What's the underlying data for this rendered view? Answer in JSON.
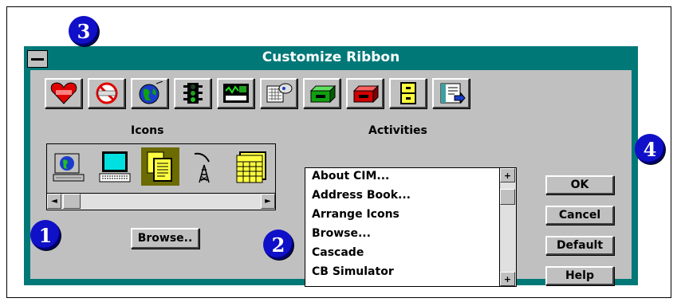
{
  "dialog": {
    "title": "Customize Ribbon"
  },
  "callouts": [
    "1",
    "2",
    "3",
    "4"
  ],
  "toolbar": {
    "buttons": [
      {
        "icon": "heart-icon"
      },
      {
        "icon": "no-entry-icon"
      },
      {
        "icon": "globe-icon"
      },
      {
        "icon": "traffic-light-icon"
      },
      {
        "icon": "monitor-chart-icon"
      },
      {
        "icon": "puzzle-icon"
      },
      {
        "icon": "green-box-icon"
      },
      {
        "icon": "red-box-icon"
      },
      {
        "icon": "file-cabinet-icon"
      },
      {
        "icon": "book-arrow-icon"
      }
    ]
  },
  "icons_panel": {
    "heading": "Icons",
    "items": [
      "computer-globe-icon",
      "terminal-icon",
      "documents-icon",
      "antenna-tower-icon",
      "calendar-icon"
    ],
    "selected_index": 2
  },
  "activities": {
    "heading": "Activities",
    "items": [
      "About CIM...",
      "Address Book...",
      "Arrange Icons",
      "Browse...",
      "Cascade",
      "CB Simulator"
    ]
  },
  "buttons": {
    "browse": "Browse..",
    "ok": "OK",
    "cancel": "Cancel",
    "default": "Default",
    "help": "Help"
  },
  "colors": {
    "title_bar": "#007878",
    "face": "#c0c0c0",
    "callout": "#1010c8"
  }
}
